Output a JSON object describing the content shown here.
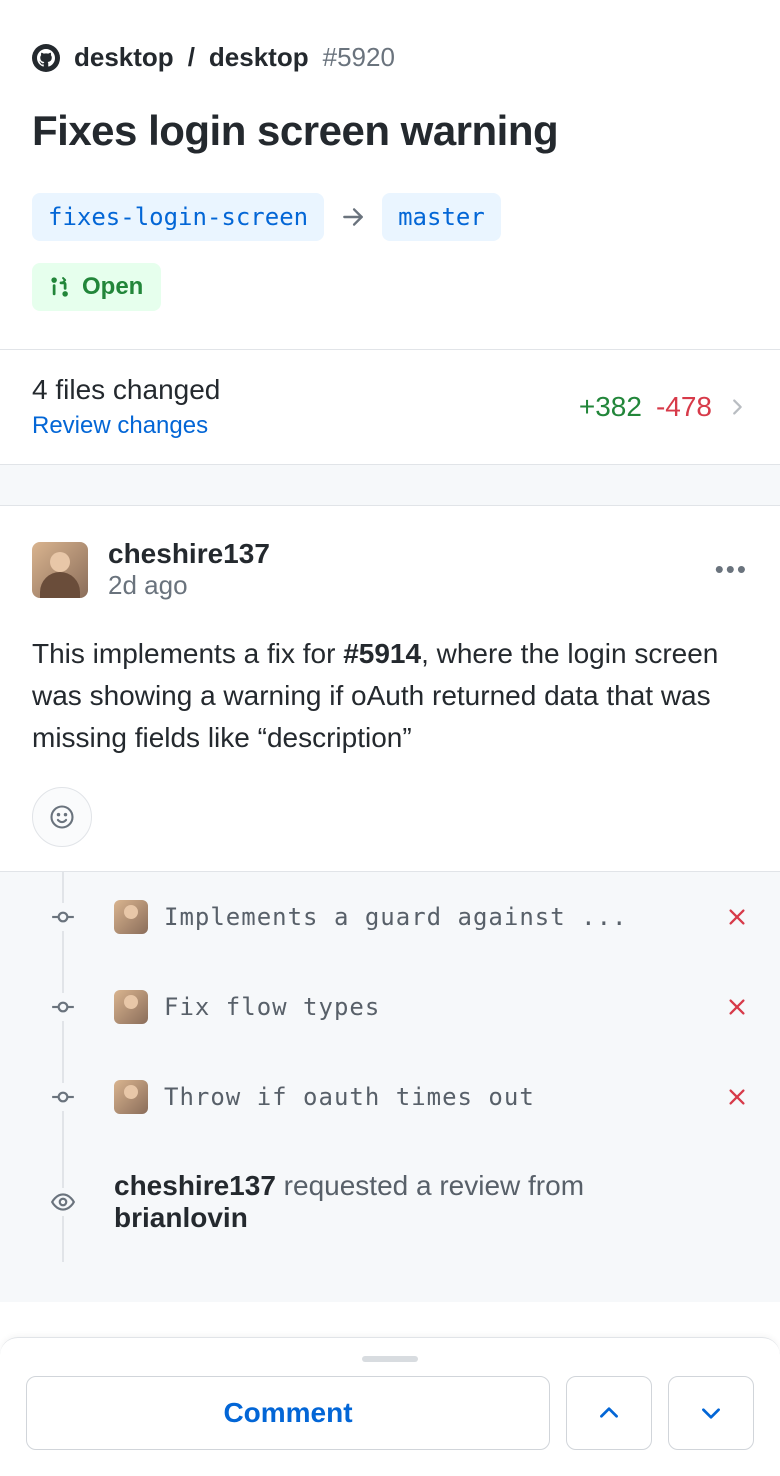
{
  "crumb": {
    "owner": "desktop",
    "slash": "/",
    "repo": "desktop",
    "issue": "#5920"
  },
  "pr_title": "Fixes login screen warning",
  "branches": {
    "source": "fixes-login-screen",
    "target": "master"
  },
  "status_label": "Open",
  "files": {
    "count_label": "4 files changed",
    "review_label": "Review changes",
    "additions": "+382",
    "deletions": "-478"
  },
  "comment": {
    "user": "cheshire137",
    "time": "2d ago",
    "body_pre": "This implements a fix for ",
    "body_ref": "#5914",
    "body_post": ", where the login screen was showing a warning if oAuth returned data that was missing fields like “description”"
  },
  "timeline": {
    "commits": [
      {
        "message": "Implements a guard against ..."
      },
      {
        "message": "Fix flow types"
      },
      {
        "message": "Throw if oauth times out"
      }
    ],
    "review_request": {
      "actor": "cheshire137",
      "verb": " requested a review from ",
      "target": "brianlovin"
    }
  },
  "bottom": {
    "comment_label": "Comment"
  }
}
